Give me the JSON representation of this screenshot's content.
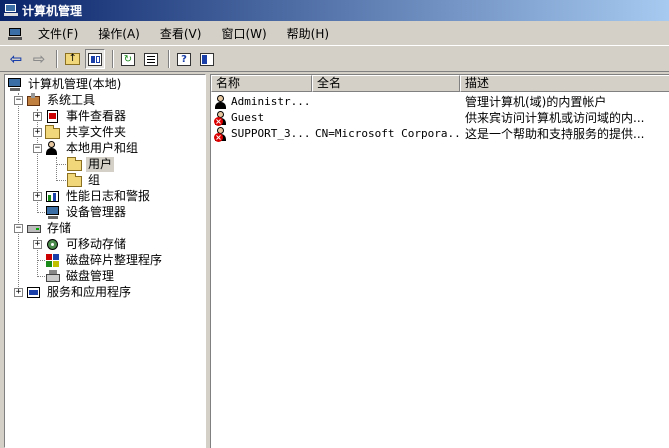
{
  "window": {
    "title": "计算机管理"
  },
  "menu": {
    "items": [
      "文件(F)",
      "操作(A)",
      "查看(V)",
      "窗口(W)",
      "帮助(H)"
    ]
  },
  "toolbar": {
    "buttons": [
      "back-icon",
      "forward-icon",
      "up-folder-icon",
      "show-hide-tree-icon",
      "refresh-icon",
      "export-list-icon",
      "help-icon",
      "console-tree-icon"
    ]
  },
  "tree": {
    "root": "计算机管理(本地)",
    "system_tools": "系统工具",
    "event_viewer": "事件查看器",
    "shared_folders": "共享文件夹",
    "local_users": "本地用户和组",
    "users": "用户",
    "groups": "组",
    "perf_logs": "性能日志和警报",
    "device_manager": "设备管理器",
    "storage": "存储",
    "removable": "可移动存储",
    "defrag": "磁盘碎片整理程序",
    "disk_mgmt": "磁盘管理",
    "services_apps": "服务和应用程序"
  },
  "list": {
    "columns": [
      "名称",
      "全名",
      "描述"
    ],
    "rows": [
      {
        "name": "Administr...",
        "fullname": "",
        "desc": "管理计算机(域)的内置帐户",
        "disabled": false
      },
      {
        "name": "Guest",
        "fullname": "",
        "desc": "供来宾访问计算机或访问域的内...",
        "disabled": true
      },
      {
        "name": "SUPPORT_3...",
        "fullname": "CN=Microsoft Corpora...",
        "desc": "这是一个帮助和支持服务的提供...",
        "disabled": true
      }
    ]
  },
  "colors": {
    "title_start": "#0a246a",
    "title_end": "#a6caf0",
    "face": "#d4d0c8"
  }
}
